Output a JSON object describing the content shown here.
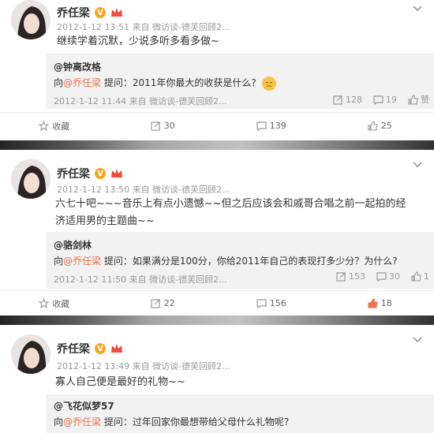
{
  "posts": [
    {
      "author": "乔任梁",
      "verified_badge": "V",
      "time": "2012-1-12 13:51",
      "source": "来自 微访谈-德芙回顾2...",
      "content": "继续学着沉默，少说多听多看多做~",
      "quote": {
        "user": "@钟离改格",
        "prefix": "向",
        "at_user": "@乔任梁",
        "question": " 提问：2011年你最大的收获是什么?",
        "time": "2012-1-12 11:44",
        "source": "来自 微访谈-德芙回顾2...",
        "reposts": "128",
        "comments": "19",
        "likes": "赞"
      },
      "actions": {
        "favorite": "收藏",
        "repost": "30",
        "comment": "139",
        "like": "25"
      }
    },
    {
      "author": "乔任梁",
      "verified_badge": "V",
      "time": "2012-1-12 13:50",
      "source": "来自 微访谈-德芙回顾2...",
      "content": "六七十吧~~~音乐上有点小遗憾~~但之后应该会和戚哥合唱之前一起拍的经济适用男的主题曲~~",
      "quote": {
        "user": "@骆剑林",
        "prefix": "向",
        "at_user": "@乔任梁",
        "question": " 提问：如果满分是100分，你给2011年自己的表现打多少分？为什么?",
        "time": "2012-1-12 11:50",
        "source": "来自 微访谈-德芙回顾2...",
        "reposts": "153",
        "comments": "30",
        "likes": "1"
      },
      "actions": {
        "favorite": "收藏",
        "repost": "22",
        "comment": "156",
        "like": "18"
      }
    },
    {
      "author": "乔任梁",
      "verified_badge": "V",
      "time": "2012-1-12 13:49",
      "source": "来自 微访谈-德芙回顾2...",
      "content": "寡人自己便是最好的礼物~~",
      "quote": {
        "user": "@飞花似梦57",
        "prefix": "向",
        "at_user": "@乔任梁",
        "question": " 提问：过年回家你最想带给父母什么礼物呢?"
      }
    }
  ],
  "colors": {
    "link": "#eb7350",
    "like_active": "#eb7350",
    "badge": "#f5a623"
  }
}
